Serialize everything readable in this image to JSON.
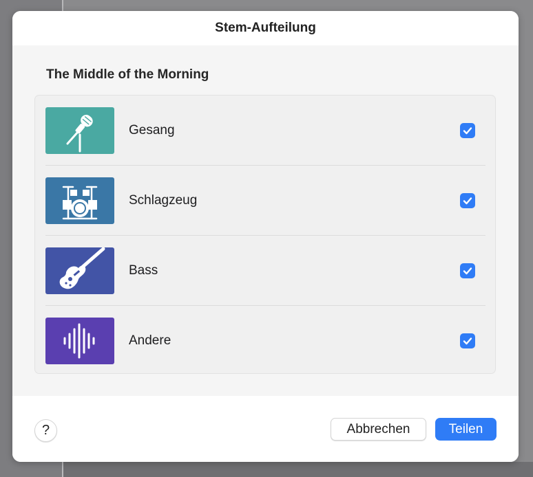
{
  "dialog": {
    "title": "Stem-Aufteilung",
    "song_title": "The Middle of the Morning"
  },
  "stems": [
    {
      "label": "Gesang",
      "icon": "microphone-icon",
      "color": "#4aa9a2",
      "checked": true
    },
    {
      "label": "Schlagzeug",
      "icon": "drum-kit-icon",
      "color": "#3a77a6",
      "checked": true
    },
    {
      "label": "Bass",
      "icon": "bass-guitar-icon",
      "color": "#4254a6",
      "checked": true
    },
    {
      "label": "Andere",
      "icon": "waveform-icon",
      "color": "#5a3fb0",
      "checked": true
    }
  ],
  "footer": {
    "help_label": "?",
    "cancel_label": "Abbrechen",
    "share_label": "Teilen"
  },
  "colors": {
    "accent": "#2f7cf6"
  }
}
